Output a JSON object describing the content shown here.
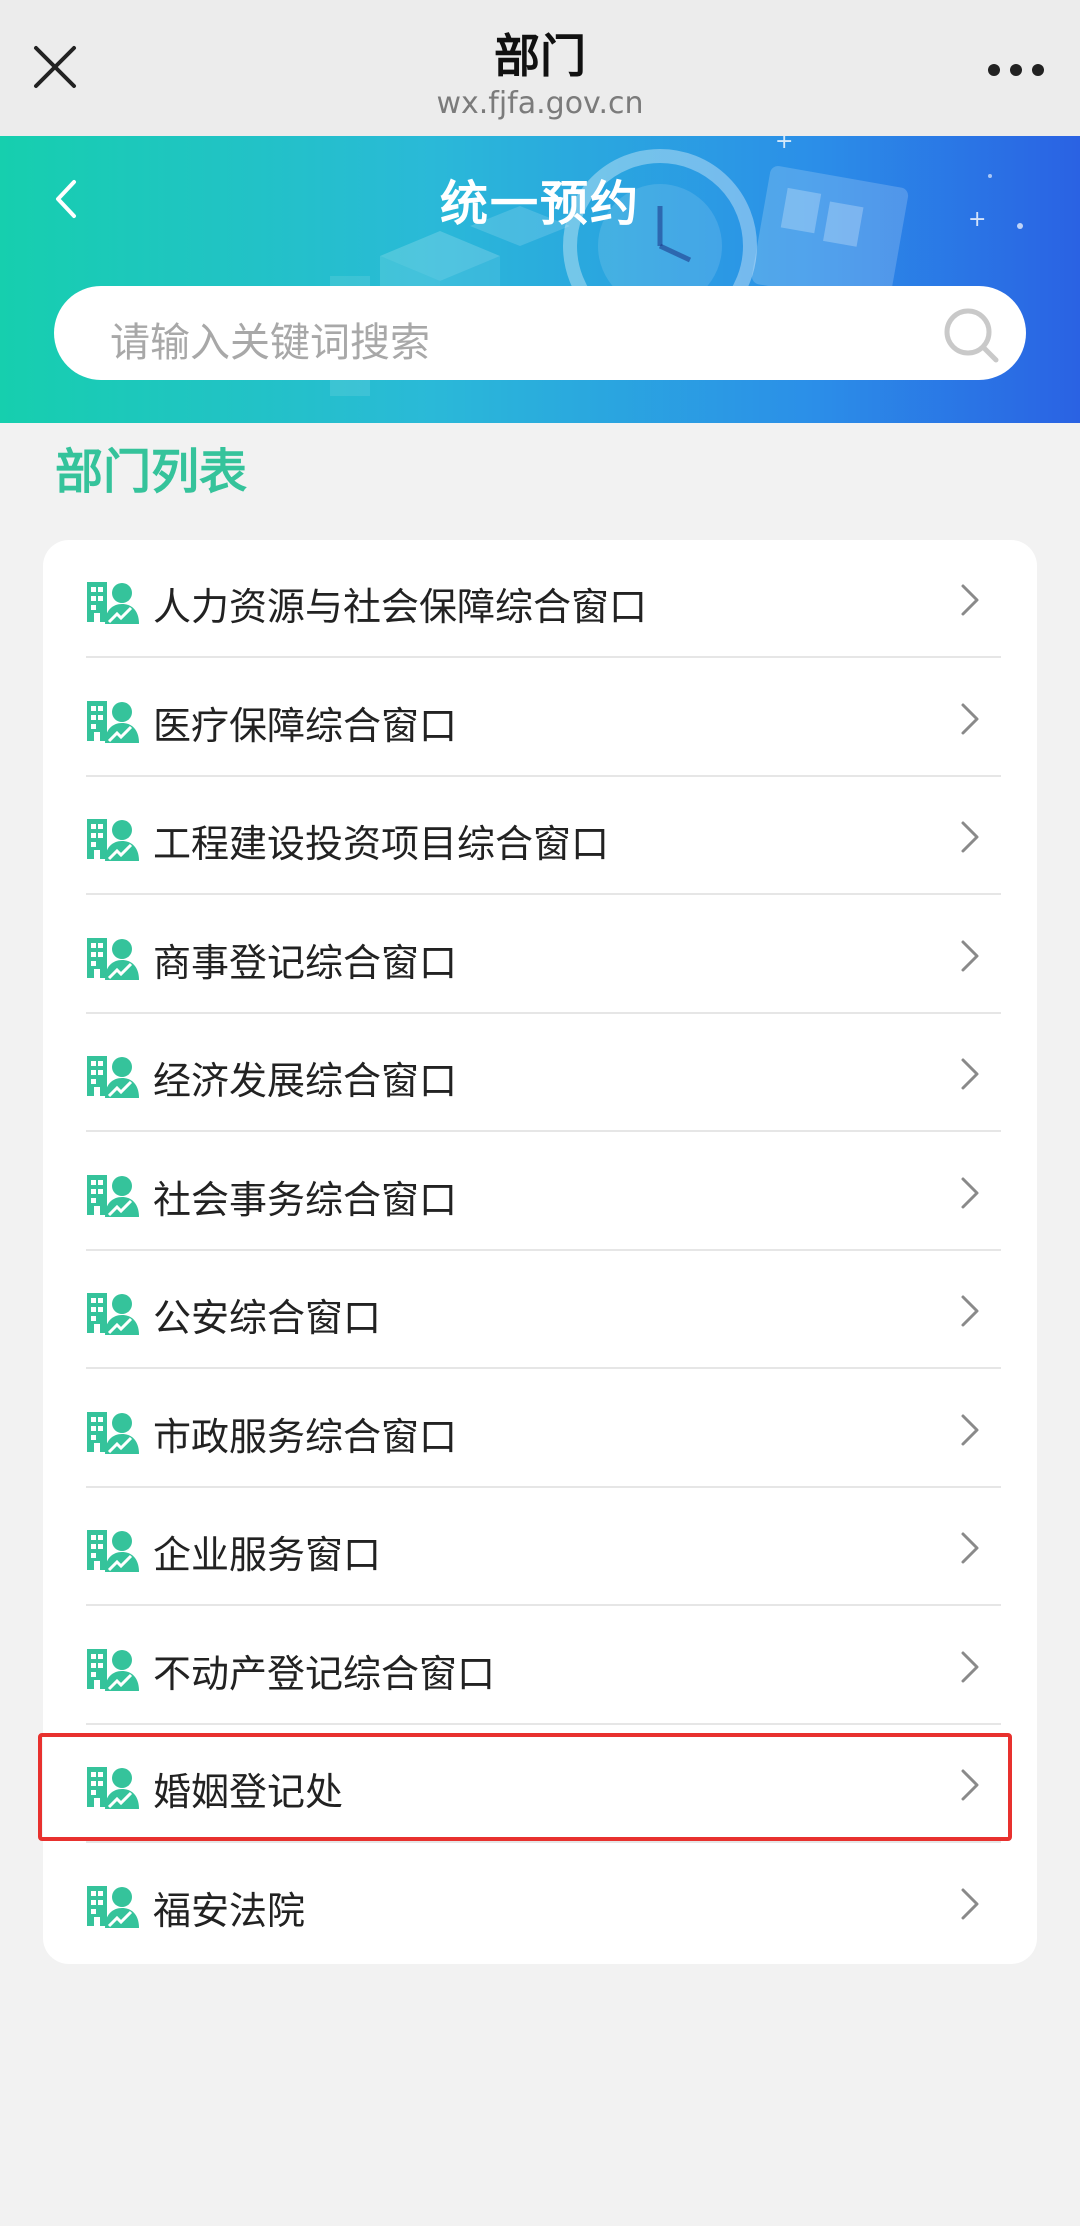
{
  "topbar": {
    "title": "部门",
    "url": "wx.fjfa.gov.cn"
  },
  "banner": {
    "heading": "统一预约"
  },
  "search": {
    "placeholder": "请输入关键词搜索"
  },
  "section": {
    "title": "部门列表"
  },
  "departments": [
    "人力资源与社会保障综合窗口",
    "医疗保障综合窗口",
    "工程建设投资项目综合窗口",
    "商事登记综合窗口",
    "经济发展综合窗口",
    "社会事务综合窗口",
    "公安综合窗口",
    "市政服务综合窗口",
    "企业服务窗口",
    "不动产登记综合窗口",
    "婚姻登记处",
    "福安法院"
  ],
  "highlighted_item": "婚姻登记处",
  "colors": {
    "accent_green": "#35c39b",
    "banner_start": "#16cfae",
    "banner_end": "#2a62e3",
    "highlight_red": "#e8312e"
  },
  "icons": {
    "close": "close-icon",
    "more": "more-icon",
    "back": "back-icon",
    "search": "search-icon",
    "department": "department-icon",
    "chevron": "chevron-right-icon"
  }
}
